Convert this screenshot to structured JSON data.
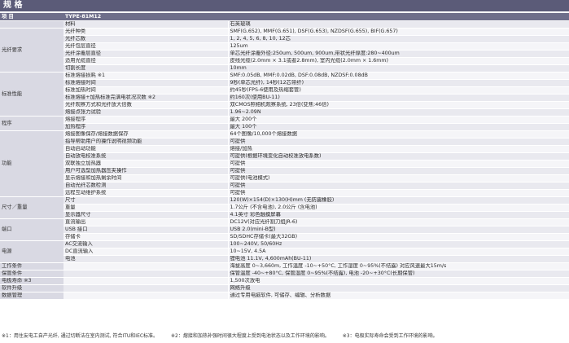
{
  "title": "规 格",
  "header": {
    "item": "项 目",
    "model": "TYPE-81M12"
  },
  "groups": [
    {
      "name": "",
      "rows": [
        {
          "sub": "材料",
          "val": "石英玻璃"
        }
      ]
    },
    {
      "name": "光纤要求",
      "rows": [
        {
          "sub": "光纤种类",
          "val": "SMF(G.652), MMF(G.651), DSF(G.653), NZDSF(G.655), BIF(G.657)"
        },
        {
          "sub": "光纤芯数",
          "val": "1, 2, 4, 5, 6, 8, 10, 12芯"
        },
        {
          "sub": "光纤包层直径",
          "val": "125um"
        },
        {
          "sub": "光纤涂覆层直径",
          "val": "单芯光纤涂覆外径:250um, 500um, 900um,带状光纤厚度:280~400um"
        },
        {
          "sub": "适用光缆直径",
          "val": "皮线光缆(2.0mm × 3.1或者2.8mm), 室内光缆(2.0mm × 1.6mm)"
        },
        {
          "sub": "切割长度",
          "val": "10mm"
        }
      ]
    },
    {
      "name": "标准性能",
      "rows": [
        {
          "sub": "标准熔接损耗 ※1",
          "val": "SMF:0.05dB, MMF:0.02dB, DSF:0.08dB, NZDSF:0.08dB"
        },
        {
          "sub": "标准熔接时间",
          "val": "9秒(单芯光纤), 14秒(12芯带纤)"
        },
        {
          "sub": "标准加热时间",
          "val": "约45秒(FPS-6使用及热缩套管)"
        },
        {
          "sub": "标准熔接+加热标准完满电状况次数 ※2",
          "val": "约160次(使用BU-11)"
        },
        {
          "sub": "光纤观察方式和光纤放大倍数",
          "val": "双CMOS照相机观察系统, 23倍(变焦:46倍)"
        },
        {
          "sub": "熔接点张力试验",
          "val": "1.96~2.09N"
        }
      ]
    },
    {
      "name": "程序",
      "rows": [
        {
          "sub": "熔接程序",
          "val": "最大 200个"
        },
        {
          "sub": "加热程序",
          "val": "最大 100个"
        }
      ]
    },
    {
      "name": "功能",
      "rows": [
        {
          "sub": "熔接图像保存/熔接数据保存",
          "val": "64个图像/10,000个熔接数据"
        },
        {
          "sub": "指导帮助用户的操作说明视频功能",
          "val": "可提供"
        },
        {
          "sub": "自动启动功能",
          "val": "熔接/加热"
        },
        {
          "sub": "自动放电校准系统",
          "val": "可提供(根据环境变化自动校准放电系数)"
        },
        {
          "sub": "双联独立加热器",
          "val": "可提供"
        },
        {
          "sub": "用户可选型加热器压夹操作",
          "val": "可提供"
        },
        {
          "sub": "显示熔接和加热剩余时间",
          "val": "可提供(电池模式)"
        },
        {
          "sub": "自动光纤芯数检测",
          "val": "可提供"
        },
        {
          "sub": "远程互动维护系统",
          "val": "可提供"
        }
      ]
    },
    {
      "name": "尺寸／重量",
      "rows": [
        {
          "sub": "尺寸",
          "val": "120(W)×154(D)×130(H)mm (无防震橡胶)"
        },
        {
          "sub": "重量",
          "val": "1.7公斤 (不含电池), 2.0公斤 (含电池)"
        },
        {
          "sub": "显示器尺寸",
          "val": "4.1英寸 彩色触摸屏幕"
        }
      ]
    },
    {
      "name": "端口",
      "rows": [
        {
          "sub": "直流输出",
          "val": "DC12V(对应光纤割刀组JR-6)"
        },
        {
          "sub": "USB 接口",
          "val": "USB 2.0(mini-B型)"
        },
        {
          "sub": "存储卡",
          "val": "SD/SDHC存储卡(最大32GB)"
        }
      ]
    },
    {
      "name": "电源",
      "rows": [
        {
          "sub": "AC交流输入",
          "val": "100~240V, 50/60Hz"
        },
        {
          "sub": "DC直流输入",
          "val": "10~15V, 4.5A"
        },
        {
          "sub": "电池",
          "val": "锂电池 11.1V, 4,600mAh(BU-11)"
        }
      ]
    },
    {
      "name": "工作条件",
      "rows": [
        {
          "sub": "",
          "val": "海拔高度 0~3,660m, 工作温度 -10~+50°C, 工作湿度 0~95%(不结露) 对应风速最大15m/s"
        }
      ]
    },
    {
      "name": "保管条件",
      "rows": [
        {
          "sub": "",
          "val": "保管温度 -40~+80°C, 保管湿度 0~95%(不结露), 电池 -20~+30°C(长期保管)"
        }
      ]
    },
    {
      "name": "电极寿命 ※3",
      "rows": [
        {
          "sub": "",
          "val": "1,500次放电"
        }
      ]
    },
    {
      "name": "软件升级",
      "rows": [
        {
          "sub": "",
          "val": "网络升级"
        }
      ]
    },
    {
      "name": "数据管理",
      "rows": [
        {
          "sub": "",
          "val": "通过专用电脑软件, 可储存、编辑、分析数据"
        }
      ]
    }
  ],
  "footnotes": [
    "※1：用住友电工自产光纤, 通过切断法在室内测试, 符合ITU和IEC标准。",
    "※2：熔接和加热补强时间很大程度上受到电池状态以及工作环境的影响。",
    "※3：电极实际寿命会受到工作环境的影响。"
  ]
}
